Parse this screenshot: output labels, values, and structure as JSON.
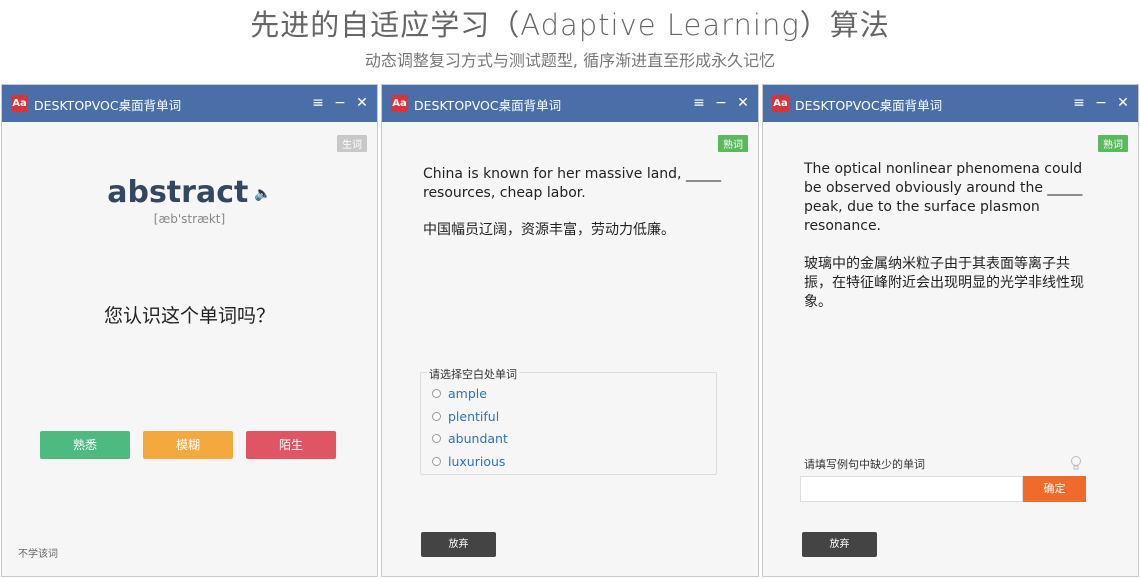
{
  "hero": {
    "title": "先进的自适应学习（Adaptive Learning）算法",
    "subtitle": "动态调整复习方式与测试题型, 循序渐进直至形成永久记忆"
  },
  "app": {
    "title": "DESKTOPVOC桌面背单词",
    "icon_text": "Aa",
    "menu_glyph": "≡",
    "min_glyph": "−",
    "close_glyph": "✕"
  },
  "window1": {
    "badge": "生词",
    "word": "abstract",
    "speaker_glyph": "🔈",
    "phonetic": "[æb'strækt]",
    "question": "您认识这个单词吗？",
    "buttons": {
      "familiar": "熟悉",
      "vague": "模糊",
      "strange": "陌生"
    },
    "skip": "不学该词",
    "colors": {
      "familiar": "#4dbb80",
      "vague": "#f4a93f",
      "strange": "#e05563"
    }
  },
  "window2": {
    "badge": "熟词",
    "sentence": "China is known for her massive land, _____ resources, cheap labor.",
    "sentence_cn": "中国幅员辽阔，资源丰富，劳动力低廉。",
    "choices_label": "请选择空白处单词",
    "options": [
      "ample",
      "plentiful",
      "abundant",
      "luxurious"
    ],
    "giveup": "放弃"
  },
  "window3": {
    "badge": "熟词",
    "sentence": "The optical nonlinear phenomena could be observed obviously around the _____ peak, due to the surface plasmon resonance.",
    "sentence_cn": "玻璃中的金属纳米粒子由于其表面等离子共振，在特征峰附近会出现明显的光学非线性现象。",
    "fill_label": "请填写例句中缺少的单词",
    "hint_icon": "lightbulb-icon",
    "input_value": "",
    "confirm": "确定",
    "giveup": "放弃"
  }
}
